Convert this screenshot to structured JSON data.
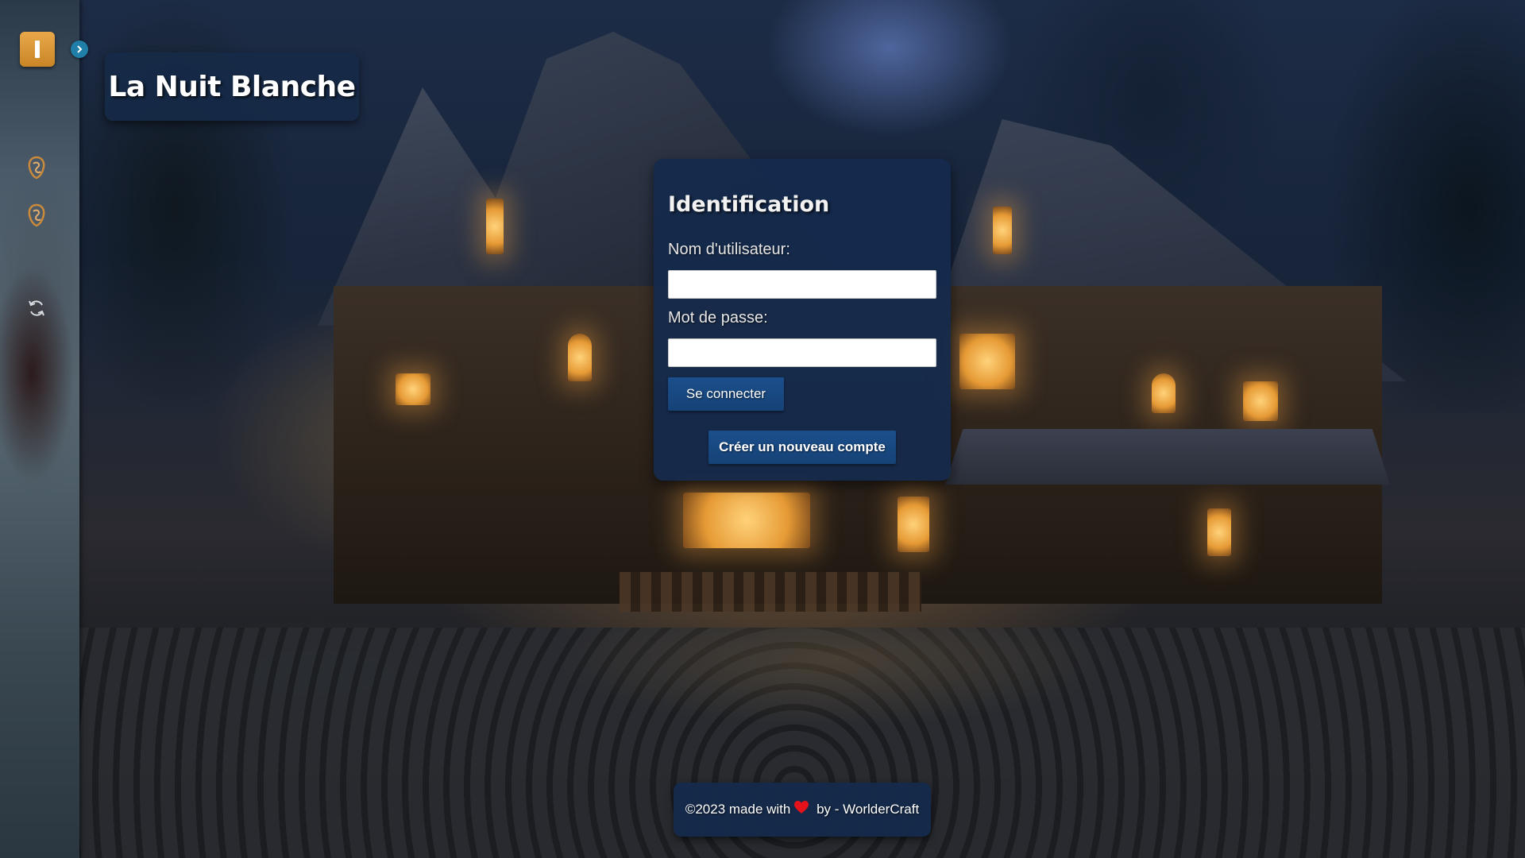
{
  "app": {
    "title": "La Nuit Blanche"
  },
  "sidebar": {
    "logo_icon": "tavern-logo-icon",
    "expand_icon": "chevron-right-icon",
    "items": [
      {
        "icon": "dragon-emblem-icon"
      },
      {
        "icon": "dragon-emblem-icon"
      },
      {
        "icon": "refresh-icon"
      }
    ]
  },
  "login": {
    "title": "Identification",
    "username_label": "Nom d'utilisateur:",
    "username_value": "",
    "password_label": "Mot de passe:",
    "password_value": "",
    "submit_label": "Se connecter",
    "create_account_label": "Créer un nouveau compte"
  },
  "footer": {
    "prefix": "©2023 made with",
    "heart_icon": "heart-icon",
    "suffix": " by - WorlderCraft"
  },
  "colors": {
    "panel_bg": "#142a4c",
    "button_bg": "#1b4f8c",
    "logo_bg": "#e8a84a",
    "expand_bg": "#1f7fa8",
    "heart": "#e3121b"
  }
}
